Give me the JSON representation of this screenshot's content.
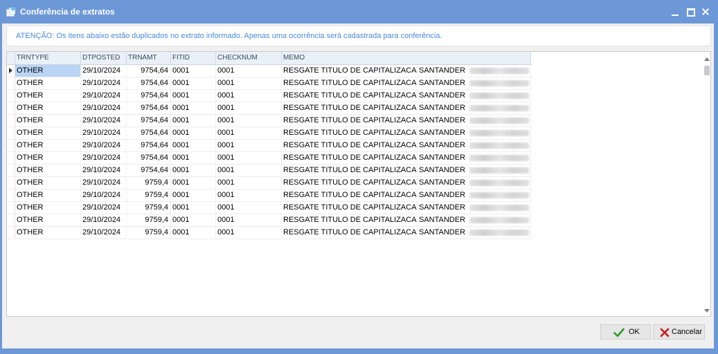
{
  "window": {
    "title": "Conferência de extratos",
    "accent_color": "#6d98d8"
  },
  "warning": {
    "text": "ATENÇÃO: Os itens abaixo estão duplicados no extrato informado. Apenas uma ocorrência será cadastrada para conferência.",
    "color": "#4a8ad8"
  },
  "grid": {
    "columns": [
      "TRNTYPE",
      "DTPOSTED",
      "TRNAMT",
      "FITID",
      "CHECKNUM",
      "MEMO"
    ],
    "rows": [
      {
        "trntype": "OTHER",
        "dtposted": "29/10/2024",
        "trnamt": "9754,64",
        "fitid": "0001",
        "checknum": "0001",
        "memo": "RESGATE TITULO DE CAPITALIZACAO",
        "bank": "SANTANDER"
      },
      {
        "trntype": "OTHER",
        "dtposted": "29/10/2024",
        "trnamt": "9754,64",
        "fitid": "0001",
        "checknum": "0001",
        "memo": "RESGATE TITULO DE CAPITALIZACAO",
        "bank": "SANTANDER"
      },
      {
        "trntype": "OTHER",
        "dtposted": "29/10/2024",
        "trnamt": "9754,64",
        "fitid": "0001",
        "checknum": "0001",
        "memo": "RESGATE TITULO DE CAPITALIZACAO",
        "bank": "SANTANDER"
      },
      {
        "trntype": "OTHER",
        "dtposted": "29/10/2024",
        "trnamt": "9754,64",
        "fitid": "0001",
        "checknum": "0001",
        "memo": "RESGATE TITULO DE CAPITALIZACAO",
        "bank": "SANTANDER"
      },
      {
        "trntype": "OTHER",
        "dtposted": "29/10/2024",
        "trnamt": "9754,64",
        "fitid": "0001",
        "checknum": "0001",
        "memo": "RESGATE TITULO DE CAPITALIZACAO",
        "bank": "SANTANDER"
      },
      {
        "trntype": "OTHER",
        "dtposted": "29/10/2024",
        "trnamt": "9754,64",
        "fitid": "0001",
        "checknum": "0001",
        "memo": "RESGATE TITULO DE CAPITALIZACAO",
        "bank": "SANTANDER"
      },
      {
        "trntype": "OTHER",
        "dtposted": "29/10/2024",
        "trnamt": "9754,64",
        "fitid": "0001",
        "checknum": "0001",
        "memo": "RESGATE TITULO DE CAPITALIZACAO",
        "bank": "SANTANDER"
      },
      {
        "trntype": "OTHER",
        "dtposted": "29/10/2024",
        "trnamt": "9754,64",
        "fitid": "0001",
        "checknum": "0001",
        "memo": "RESGATE TITULO DE CAPITALIZACAO",
        "bank": "SANTANDER"
      },
      {
        "trntype": "OTHER",
        "dtposted": "29/10/2024",
        "trnamt": "9754,64",
        "fitid": "0001",
        "checknum": "0001",
        "memo": "RESGATE TITULO DE CAPITALIZACAO",
        "bank": "SANTANDER"
      },
      {
        "trntype": "OTHER",
        "dtposted": "29/10/2024",
        "trnamt": "9759,4",
        "fitid": "0001",
        "checknum": "0001",
        "memo": "RESGATE TITULO DE CAPITALIZACAO",
        "bank": "SANTANDER"
      },
      {
        "trntype": "OTHER",
        "dtposted": "29/10/2024",
        "trnamt": "9759,4",
        "fitid": "0001",
        "checknum": "0001",
        "memo": "RESGATE TITULO DE CAPITALIZACAO",
        "bank": "SANTANDER"
      },
      {
        "trntype": "OTHER",
        "dtposted": "29/10/2024",
        "trnamt": "9759,4",
        "fitid": "0001",
        "checknum": "0001",
        "memo": "RESGATE TITULO DE CAPITALIZACAO",
        "bank": "SANTANDER"
      },
      {
        "trntype": "OTHER",
        "dtposted": "29/10/2024",
        "trnamt": "9759,4",
        "fitid": "0001",
        "checknum": "0001",
        "memo": "RESGATE TITULO DE CAPITALIZACAO",
        "bank": "SANTANDER"
      },
      {
        "trntype": "OTHER",
        "dtposted": "29/10/2024",
        "trnamt": "9759,4",
        "fitid": "0001",
        "checknum": "0001",
        "memo": "RESGATE TITULO DE CAPITALIZACAO",
        "bank": "SANTANDER"
      }
    ]
  },
  "buttons": {
    "ok_label": "OK",
    "cancel_label": "Cancelar",
    "ok_icon": "checkmark-icon",
    "cancel_icon": "x-icon"
  }
}
